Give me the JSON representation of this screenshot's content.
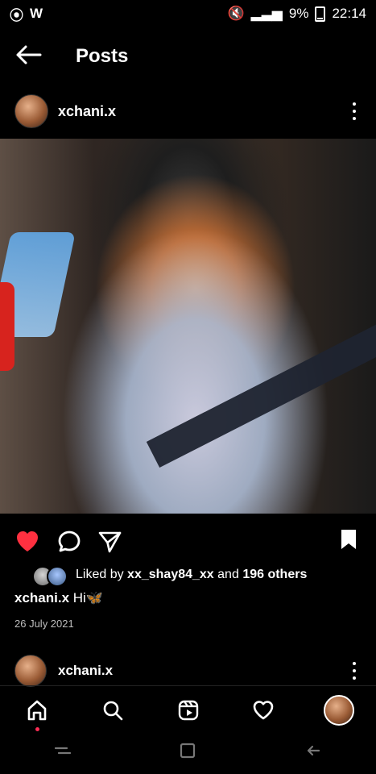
{
  "status": {
    "left_icons": [
      "messenger-icon",
      "w-icon"
    ],
    "battery": "9%",
    "time": "22:14"
  },
  "topbar": {
    "title": "Posts"
  },
  "post": {
    "username": "xchani.x",
    "liked_by_prefix": "Liked by",
    "liked_by_user": "xx_shay84_xx",
    "and_text": "and",
    "others_count": "196 others",
    "caption_user": "xchani.x",
    "caption_text": "Hi🦋",
    "date": "26 July 2021"
  },
  "next_post": {
    "username": "xchani.x"
  },
  "icons": {
    "back": "arrow-left-icon",
    "more": "more-vertical-icon",
    "like": "heart-filled-icon",
    "comment": "comment-icon",
    "share": "paper-plane-icon",
    "save": "bookmark-filled-icon",
    "home": "home-icon",
    "search": "search-icon",
    "reels": "reels-icon",
    "activity": "heart-outline-icon",
    "profile": "profile-avatar"
  },
  "colors": {
    "heart_red": "#ff3040",
    "active_dot": "#ff2d55"
  }
}
